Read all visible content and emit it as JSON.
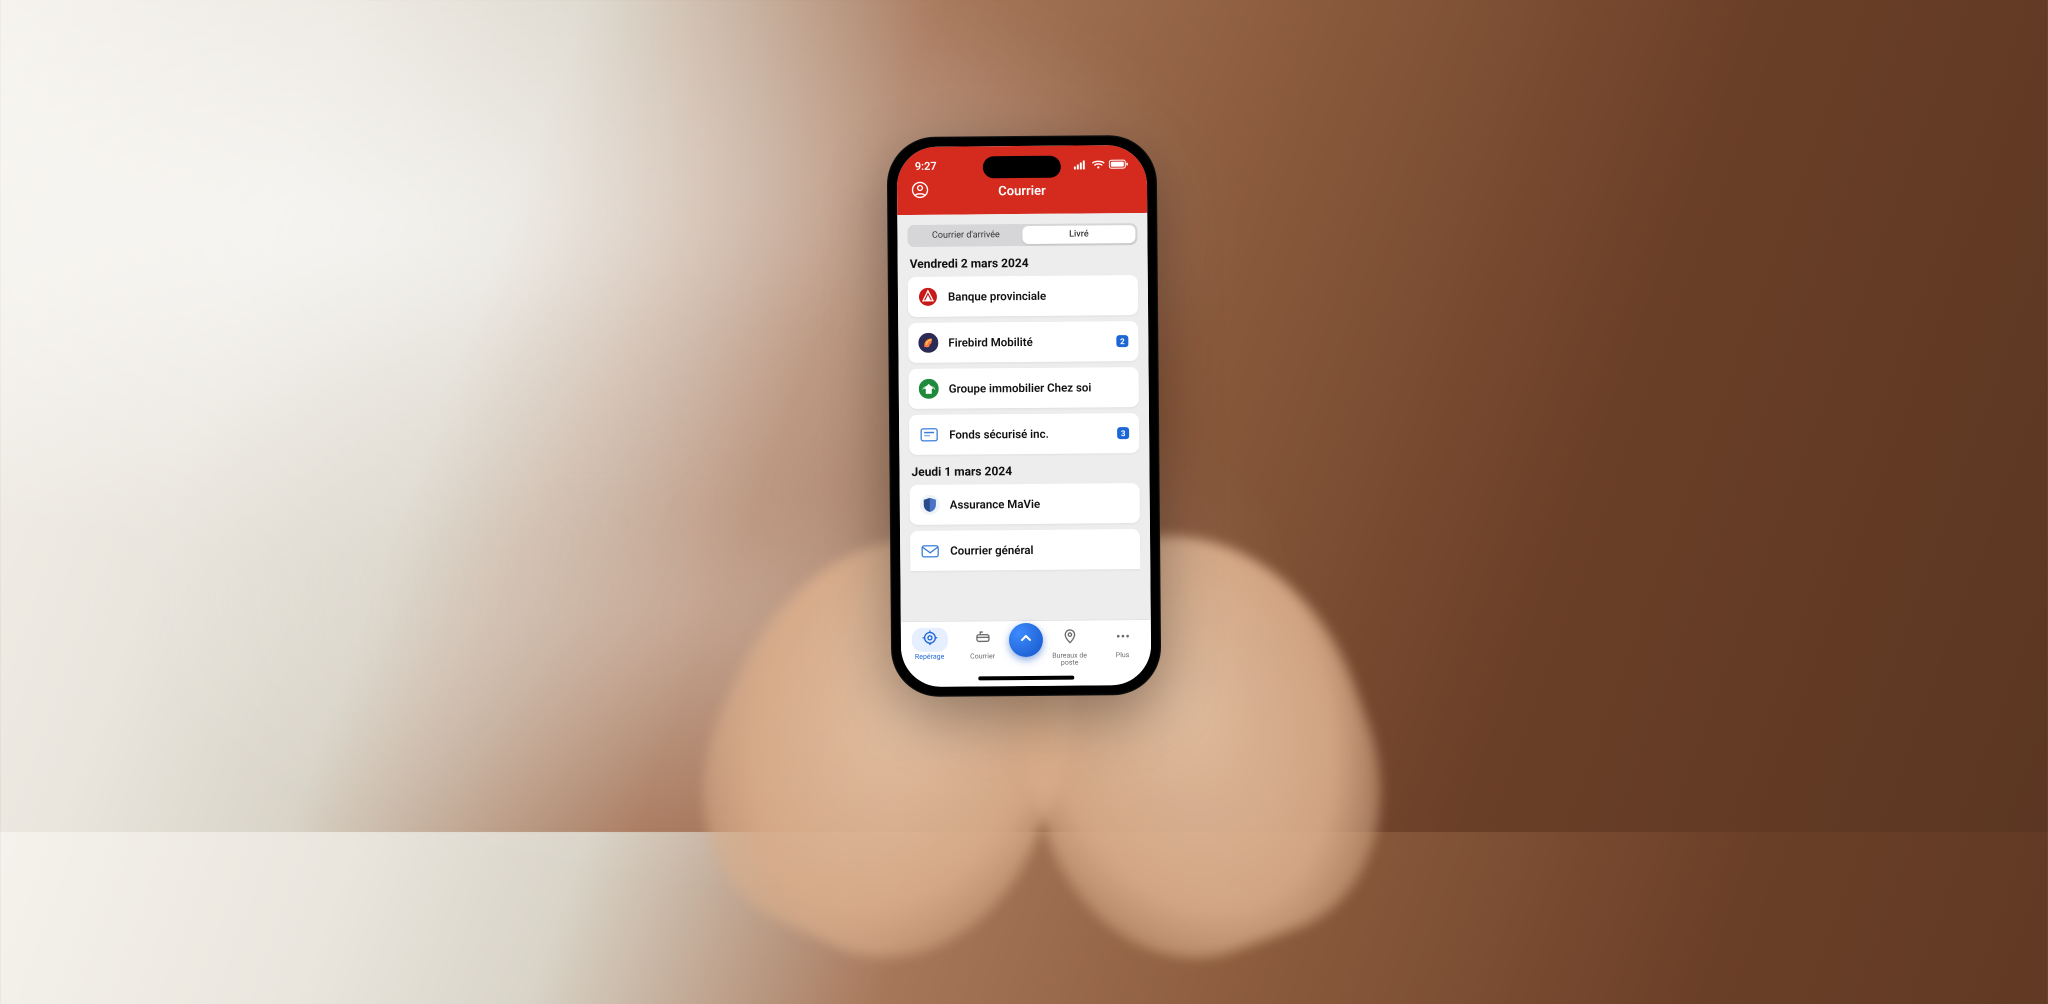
{
  "status": {
    "time": "9:27"
  },
  "header": {
    "title": "Courrier"
  },
  "segmented": {
    "tab_arriving": "Courrier d'arrivée",
    "tab_delivered": "Livré",
    "active": "delivered"
  },
  "sections": [
    {
      "title": "Vendredi 2 mars 2024",
      "items": [
        {
          "name": "Banque provinciale",
          "icon": "bank-red",
          "badge": null
        },
        {
          "name": "Firebird Mobilité",
          "icon": "firebird",
          "badge": "2"
        },
        {
          "name": "Groupe immobilier Chez soi",
          "icon": "home-green",
          "badge": null
        },
        {
          "name": "Fonds sécurisé inc.",
          "icon": "secure-blue",
          "badge": "3"
        }
      ]
    },
    {
      "title": "Jeudi 1 mars 2024",
      "items": [
        {
          "name": "Assurance MaVie",
          "icon": "shield",
          "badge": null
        },
        {
          "name": "Courrier général",
          "icon": "mail-envelope",
          "badge": null
        }
      ]
    }
  ],
  "tabs": {
    "tracking": "Repérage",
    "mail": "Courrier",
    "offices": "Bureaux de poste",
    "more": "Plus",
    "active": "tracking"
  },
  "colors": {
    "brand_red": "#d52b1e",
    "accent_blue": "#1d66d6"
  }
}
